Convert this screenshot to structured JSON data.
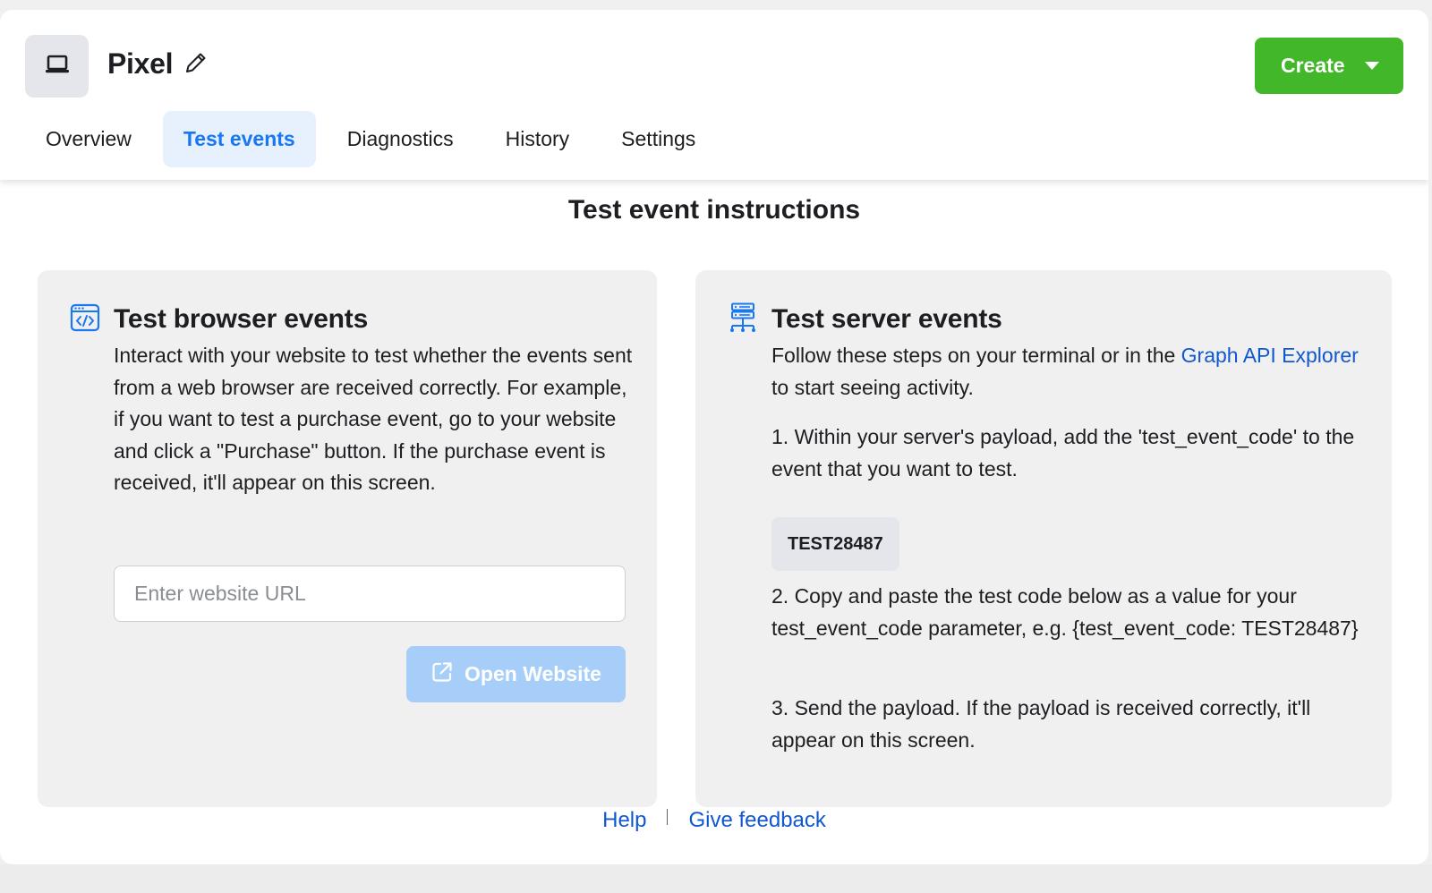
{
  "header": {
    "title": "Pixel",
    "app_icon": "laptop-icon",
    "create_label": "Create"
  },
  "tabs": [
    {
      "label": "Overview",
      "active": false
    },
    {
      "label": "Test events",
      "active": true
    },
    {
      "label": "Diagnostics",
      "active": false
    },
    {
      "label": "History",
      "active": false
    },
    {
      "label": "Settings",
      "active": false
    }
  ],
  "section_title": "Test event instructions",
  "browser_panel": {
    "icon": "browser-code-icon",
    "title": "Test browser events",
    "description": "Interact with your website to test whether the events sent from a web browser are received correctly. For example, if you want to test a purchase event, go to your website and click a \"Purchase\" button. If the purchase event is received, it'll appear on this screen.",
    "url_input_value": "",
    "url_placeholder": "Enter website URL",
    "open_label": "Open Website"
  },
  "server_panel": {
    "icon": "server-icon",
    "title": "Test server events",
    "intro_before": "Follow these steps on your terminal or in the ",
    "intro_link": "Graph API Explorer",
    "intro_after": " to start seeing activity.",
    "step1": "1. Within your server's payload, add the 'test_event_code' to the event that you want to test.",
    "test_code": "TEST28487",
    "step2": "2. Copy and paste the test code below as a value for your test_event_code parameter, e.g. {test_event_code: TEST28487}",
    "step3": "3. Send the payload. If the payload is received correctly, it'll appear on this screen."
  },
  "footer": {
    "help": "Help",
    "feedback": "Give feedback"
  },
  "colors": {
    "accent": "#1877f2",
    "create_green": "#42b72a",
    "link": "#1058d0"
  }
}
